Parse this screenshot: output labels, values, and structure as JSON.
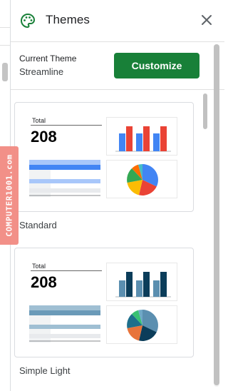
{
  "panel": {
    "title": "Themes",
    "close_icon": "close-icon",
    "header_icon": "palette-icon"
  },
  "current_theme": {
    "label": "Current Theme",
    "value": "Streamline",
    "customize_label": "Customize",
    "customize_color": "#188038"
  },
  "themes": [
    {
      "name": "Standard",
      "preview": {
        "total_label": "Total",
        "total_value": "208",
        "bar_colors": [
          "#4285f4",
          "#ea4335"
        ],
        "pie_colors": [
          "#4285f4",
          "#ea4335",
          "#fbbc04",
          "#34a853",
          "#ff6d01",
          "#46bdc6"
        ],
        "table_accent": "#4285f4"
      }
    },
    {
      "name": "Simple Light",
      "preview": {
        "total_label": "Total",
        "total_value": "208",
        "bar_colors": [
          "#5b8fb0",
          "#0b3d5a"
        ],
        "pie_colors": [
          "#5b8fb0",
          "#0b3d5a",
          "#e8743b",
          "#1e6f8c",
          "#38c172",
          "#6fa8c7"
        ],
        "table_accent": "#6a9ab8"
      }
    }
  ],
  "watermark": {
    "text": "COMPUTER1001.com"
  }
}
